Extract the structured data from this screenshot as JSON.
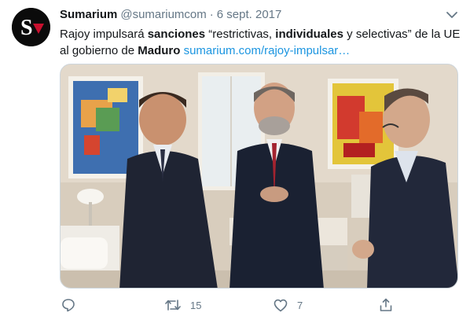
{
  "tweet": {
    "author_name": "Sumarium",
    "handle": "@sumariumcom",
    "separator": "·",
    "date": "6 sept. 2017",
    "text": {
      "p1": "Rajoy impulsará ",
      "b1": "sanciones",
      "p2": " “restrictivas, ",
      "b2": "individuales",
      "p3": " y selectivas” de la UE al gobierno de ",
      "b3": "Maduro",
      "link": "sumarium.com/rajoy-impulsar…"
    },
    "actions": {
      "reply_count": "",
      "retweet_count": "15",
      "like_count": "7"
    }
  },
  "icons": {
    "avatar": "sumarium-logo-icon",
    "more": "chevron-down-icon",
    "reply": "reply-icon",
    "retweet": "retweet-icon",
    "like": "heart-icon",
    "share": "share-icon"
  },
  "colors": {
    "link": "#1b95e0",
    "muted": "#657786",
    "text": "#14171a",
    "avatar_accent": "#c8102e"
  }
}
